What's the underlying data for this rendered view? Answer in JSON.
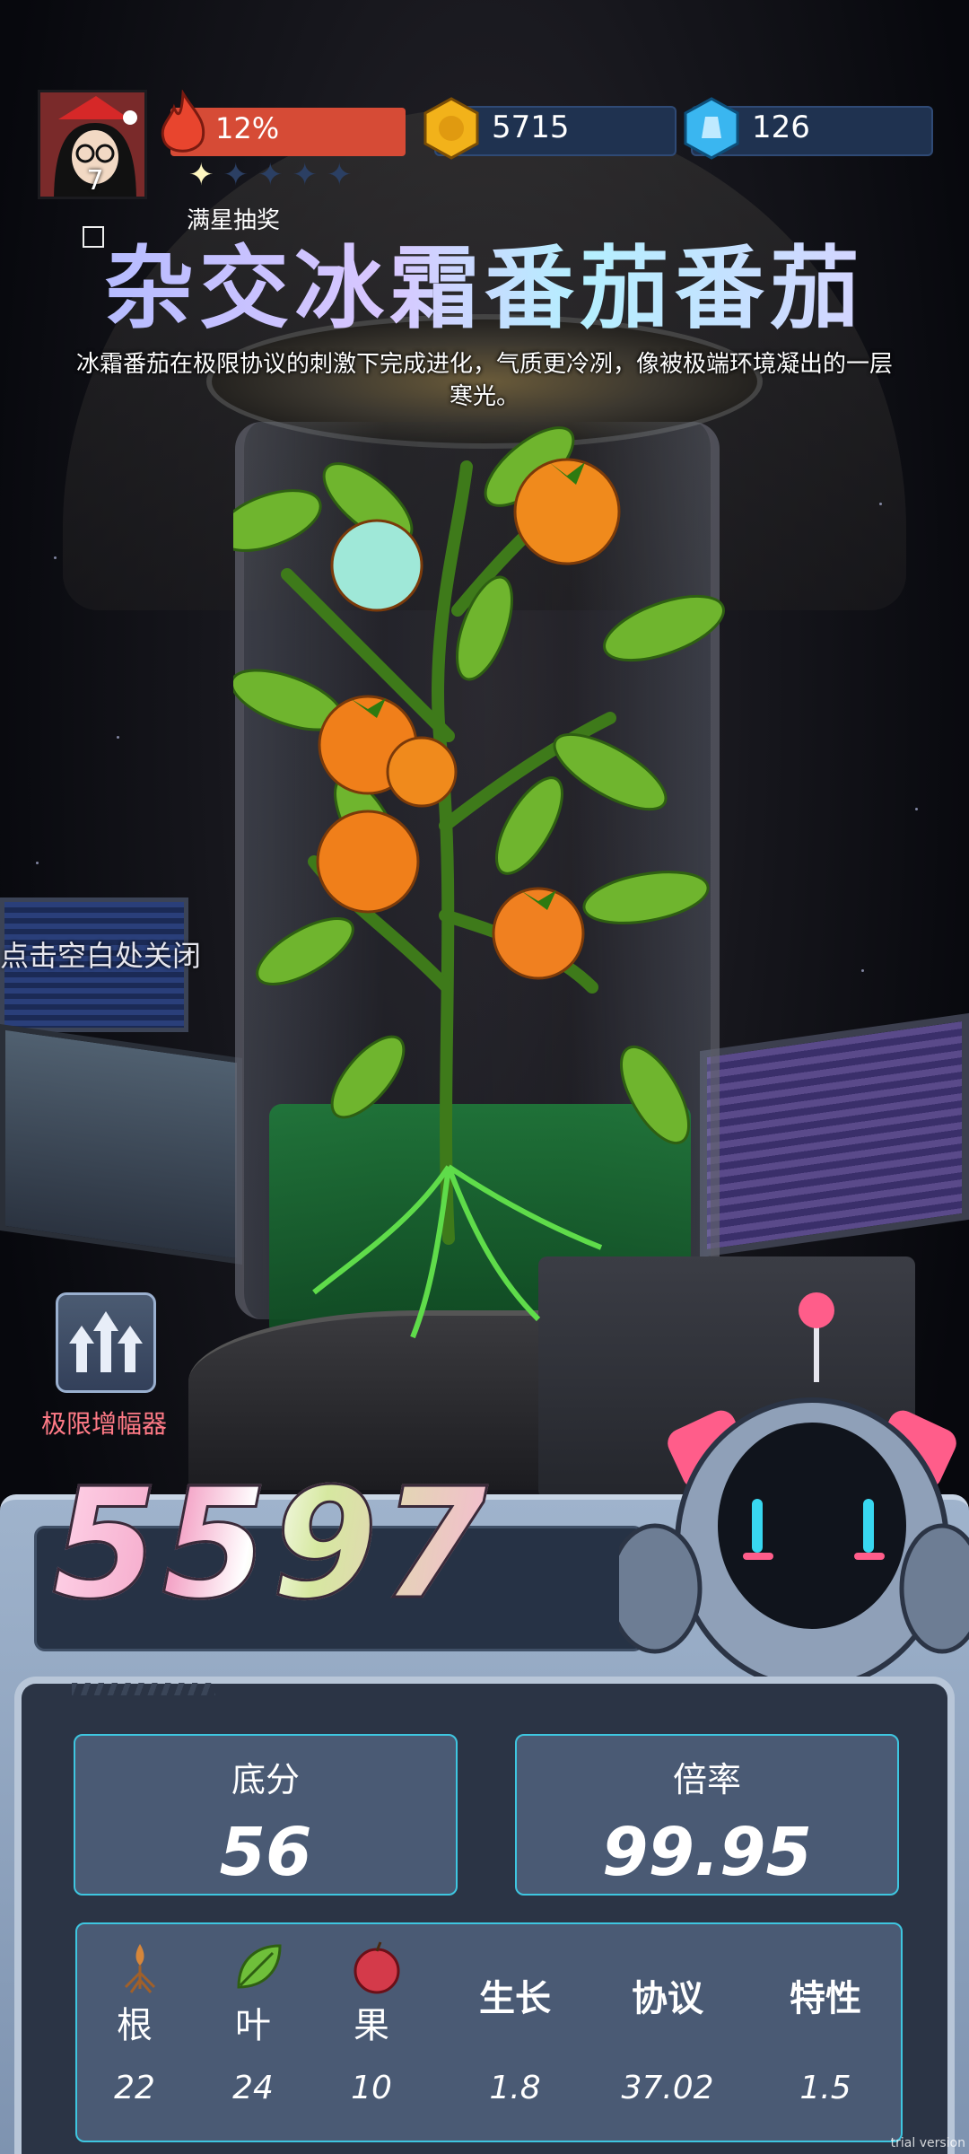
{
  "hud": {
    "level": "7",
    "progress_text": "12%",
    "progress": 0.12,
    "stars_filled": 1,
    "stars_total": 5,
    "coins": "5715",
    "gems": "126"
  },
  "lottery_label": "满星抽奖",
  "title": "杂交冰霜番茄番茄",
  "description": "冰霜番茄在极限协议的刺激下完成进化，气质更冷冽，像被极端环境凝出的一层寒光。",
  "close_hint": "点击空白处关闭",
  "amplifier": {
    "label": "极限增幅器",
    "icon": "triple-up-arrow-icon"
  },
  "score": "5597",
  "stats": [
    {
      "label": "底分",
      "value": "56"
    },
    {
      "label": "倍率",
      "value": "99.95"
    }
  ],
  "attributes": [
    {
      "label": "根",
      "value": "22",
      "icon": "root-icon"
    },
    {
      "label": "叶",
      "value": "24",
      "icon": "leaf-icon"
    },
    {
      "label": "果",
      "value": "10",
      "icon": "fruit-icon"
    },
    {
      "label": "生长",
      "value": "1.8"
    },
    {
      "label": "协议",
      "value": "37.02"
    },
    {
      "label": "特性",
      "value": "1.5"
    }
  ],
  "watermark": "trial version",
  "colors": {
    "flame_bar": "#d64b36",
    "accent_cyan": "#3ec6e0",
    "panel": "#4a5a74"
  }
}
